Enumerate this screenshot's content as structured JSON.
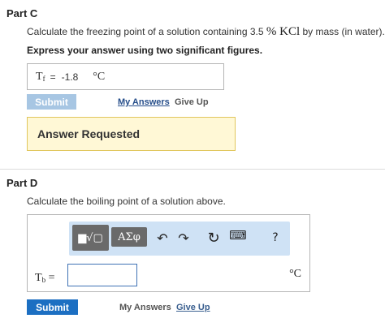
{
  "part_c": {
    "title": "Part C",
    "question_pre": "Calculate the freezing point of a solution containing 3.5",
    "question_math": "% KCl",
    "question_post": "by mass (in water).",
    "instruction": "Express your answer using two significant figures.",
    "answer": {
      "symbol": "T",
      "subscript": "f",
      "equals": "=",
      "value": "-1.8",
      "unit": "°C"
    },
    "submit_label": "Submit",
    "my_answers_label": "My Answers",
    "give_up_label": "Give Up",
    "status_banner": "Answer Requested"
  },
  "part_d": {
    "title": "Part D",
    "question": "Calculate the boiling point of a solution above.",
    "toolbar": {
      "template_label": "▆√▢",
      "greek_label": "ΑΣφ",
      "undo_glyph": "↶",
      "redo_glyph": "↷",
      "reset_glyph": "↻",
      "keyboard_glyph": "⌨",
      "help_glyph": "?"
    },
    "answer": {
      "symbol": "T",
      "subscript": "b",
      "equals": "=",
      "value": "",
      "unit": "°C"
    },
    "submit_label": "Submit",
    "my_answers_label": "My Answers",
    "give_up_label": "Give Up"
  },
  "colors": {
    "submit_active": "#1c6fc2",
    "submit_disabled": "#a7c6e3",
    "banner_bg": "#fff8d6",
    "banner_border": "#e0c65c",
    "toolbar_bg": "#cfe2f5"
  }
}
